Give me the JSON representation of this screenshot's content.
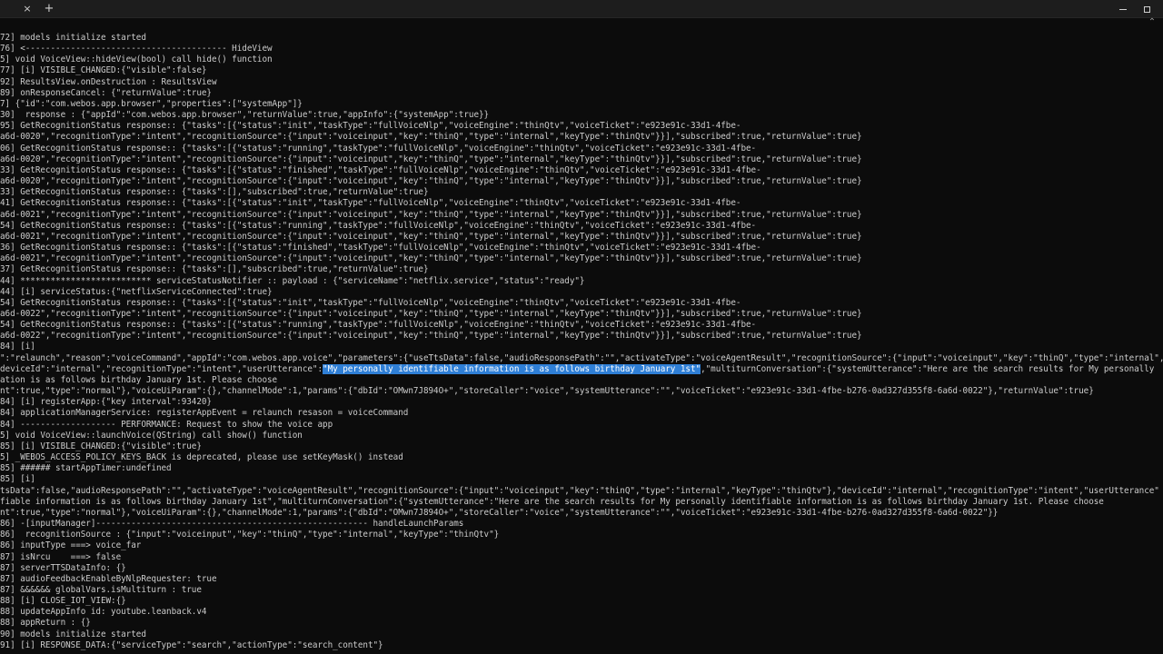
{
  "window": {
    "tab_close_icon": "×",
    "new_tab_icon": "+",
    "minimize_icon": "minimize-icon",
    "maximize_icon": "maximize-icon",
    "scroll_glyph": "⌃"
  },
  "console": {
    "lines": [
      {
        "text": "72] models initialize started"
      },
      {
        "text": "76] <---------------------------------------- HideView"
      },
      {
        "text": "5] void VoiceView::hideView(bool) call hide() function"
      },
      {
        "text": "77] [i] VISIBLE_CHANGED:{\"visible\":false}"
      },
      {
        "text": "92] ResultsView.onDestruction : ResultsView"
      },
      {
        "text": "89] onResponseCancel: {\"returnValue\":true}"
      },
      {
        "text": "7] {\"id\":\"com.webos.app.browser\",\"properties\":[\"systemApp\"]}"
      },
      {
        "text": "30]  response : {\"appId\":\"com.webos.app.browser\",\"returnValue\":true,\"appInfo\":{\"systemApp\":true}}"
      },
      {
        "text": "95] GetRecognitionStatus response:: {\"tasks\":[{\"status\":\"init\",\"taskType\":\"fullVoiceNlp\",\"voiceEngine\":\"thinQtv\",\"voiceTicket\":\"e923e91c-33d1-4fbe-"
      },
      {
        "text": "a6d-0020\",\"recognitionType\":\"intent\",\"recognitionSource\":{\"input\":\"voiceinput\",\"key\":\"thinQ\",\"type\":\"internal\",\"keyType\":\"thinQtv\"}}],\"subscribed\":true,\"returnValue\":true}"
      },
      {
        "text": "06] GetRecognitionStatus response:: {\"tasks\":[{\"status\":\"running\",\"taskType\":\"fullVoiceNlp\",\"voiceEngine\":\"thinQtv\",\"voiceTicket\":\"e923e91c-33d1-4fbe-"
      },
      {
        "text": "a6d-0020\",\"recognitionType\":\"intent\",\"recognitionSource\":{\"input\":\"voiceinput\",\"key\":\"thinQ\",\"type\":\"internal\",\"keyType\":\"thinQtv\"}}],\"subscribed\":true,\"returnValue\":true}"
      },
      {
        "text": "33] GetRecognitionStatus response:: {\"tasks\":[{\"status\":\"finished\",\"taskType\":\"fullVoiceNlp\",\"voiceEngine\":\"thinQtv\",\"voiceTicket\":\"e923e91c-33d1-4fbe-"
      },
      {
        "text": "a6d-0020\",\"recognitionType\":\"intent\",\"recognitionSource\":{\"input\":\"voiceinput\",\"key\":\"thinQ\",\"type\":\"internal\",\"keyType\":\"thinQtv\"}}],\"subscribed\":true,\"returnValue\":true}"
      },
      {
        "text": "33] GetRecognitionStatus response:: {\"tasks\":[],\"subscribed\":true,\"returnValue\":true}"
      },
      {
        "text": "41] GetRecognitionStatus response:: {\"tasks\":[{\"status\":\"init\",\"taskType\":\"fullVoiceNlp\",\"voiceEngine\":\"thinQtv\",\"voiceTicket\":\"e923e91c-33d1-4fbe-"
      },
      {
        "text": "a6d-0021\",\"recognitionType\":\"intent\",\"recognitionSource\":{\"input\":\"voiceinput\",\"key\":\"thinQ\",\"type\":\"internal\",\"keyType\":\"thinQtv\"}}],\"subscribed\":true,\"returnValue\":true}"
      },
      {
        "text": "54] GetRecognitionStatus response:: {\"tasks\":[{\"status\":\"running\",\"taskType\":\"fullVoiceNlp\",\"voiceEngine\":\"thinQtv\",\"voiceTicket\":\"e923e91c-33d1-4fbe-"
      },
      {
        "text": "a6d-0021\",\"recognitionType\":\"intent\",\"recognitionSource\":{\"input\":\"voiceinput\",\"key\":\"thinQ\",\"type\":\"internal\",\"keyType\":\"thinQtv\"}}],\"subscribed\":true,\"returnValue\":true}"
      },
      {
        "text": "36] GetRecognitionStatus response:: {\"tasks\":[{\"status\":\"finished\",\"taskType\":\"fullVoiceNlp\",\"voiceEngine\":\"thinQtv\",\"voiceTicket\":\"e923e91c-33d1-4fbe-"
      },
      {
        "text": "a6d-0021\",\"recognitionType\":\"intent\",\"recognitionSource\":{\"input\":\"voiceinput\",\"key\":\"thinQ\",\"type\":\"internal\",\"keyType\":\"thinQtv\"}}],\"subscribed\":true,\"returnValue\":true}"
      },
      {
        "text": "37] GetRecognitionStatus response:: {\"tasks\":[],\"subscribed\":true,\"returnValue\":true}"
      },
      {
        "text": "44] ************************** serviceStatusNotifier :: payload : {\"serviceName\":\"netflix.service\",\"status\":\"ready\"}"
      },
      {
        "text": "44] [i] serviceStatus:{\"netflixServiceConnected\":true}"
      },
      {
        "text": "54] GetRecognitionStatus response:: {\"tasks\":[{\"status\":\"init\",\"taskType\":\"fullVoiceNlp\",\"voiceEngine\":\"thinQtv\",\"voiceTicket\":\"e923e91c-33d1-4fbe-"
      },
      {
        "text": "a6d-0022\",\"recognitionType\":\"intent\",\"recognitionSource\":{\"input\":\"voiceinput\",\"key\":\"thinQ\",\"type\":\"internal\",\"keyType\":\"thinQtv\"}}],\"subscribed\":true,\"returnValue\":true}"
      },
      {
        "text": "54] GetRecognitionStatus response:: {\"tasks\":[{\"status\":\"running\",\"taskType\":\"fullVoiceNlp\",\"voiceEngine\":\"thinQtv\",\"voiceTicket\":\"e923e91c-33d1-4fbe-"
      },
      {
        "text": "a6d-0022\",\"recognitionType\":\"intent\",\"recognitionSource\":{\"input\":\"voiceinput\",\"key\":\"thinQ\",\"type\":\"internal\",\"keyType\":\"thinQtv\"}}],\"subscribed\":true,\"returnValue\":true}"
      },
      {
        "text": "84] [i]"
      },
      {
        "text": "\":\"relaunch\",\"reason\":\"voiceCommand\",\"appId\":\"com.webos.app.voice\",\"parameters\":{\"useTtsData\":false,\"audioResponsePath\":\"\",\"activateType\":\"voiceAgentResult\",\"recognitionSource\":{\"input\":\"voiceinput\",\"key\":\"thinQ\",\"type\":\"internal\","
      },
      {
        "text": "deviceId\":\"internal\",\"recognitionType\":\"intent\",\"userUtterance\":",
        "highlight": "\"My personally identifiable information is as follows birthday January 1st\"",
        "after": ",\"multiturnConversation\":{\"systemUtterance\":\"Here are the search results for My personally"
      },
      {
        "text": "ation is as follows birthday January 1st. Please choose"
      },
      {
        "text": "nt\":true,\"type\":\"normal\"},\"voiceUiParam\":{},\"channelMode\":1,\"params\":{\"dbId\":\"OMwn7J894O+\",\"storeCaller\":\"voice\",\"systemUtterance\":\"\",\"voiceTicket\":\"e923e91c-33d1-4fbe-b276-0ad327d355f8-6a6d-0022\"},\"returnValue\":true}"
      },
      {
        "text": "84] [i] registerApp:{\"key interval\":93420}"
      },
      {
        "text": "84] applicationManagerService: registerAppEvent = relaunch resason = voiceCommand"
      },
      {
        "text": "84] ------------------- PERFORMANCE: Request to show the voice app"
      },
      {
        "text": "5] void VoiceView::launchVoice(QString) call show() function"
      },
      {
        "text": "85] [i] VISIBLE_CHANGED:{\"visible\":true}"
      },
      {
        "text": "5] _WEBOS_ACCESS_POLICY_KEYS_BACK is deprecated, please use setKeyMask() instead"
      },
      {
        "text": "85] ###### startAppTimer:undefined"
      },
      {
        "text": "85] [i]"
      },
      {
        "text": "tsData\":false,\"audioResponsePath\":\"\",\"activateType\":\"voiceAgentResult\",\"recognitionSource\":{\"input\":\"voiceinput\",\"key\":\"thinQ\",\"type\":\"internal\",\"keyType\":\"thinQtv\"},\"deviceId\":\"internal\",\"recognitionType\":\"intent\",\"userUtterance\""
      },
      {
        "text": "fiable information is as follows birthday January 1st\",\"multiturnConversation\":{\"systemUtterance\":\"Here are the search results for My personally identifiable information is as follows birthday January 1st. Please choose"
      },
      {
        "text": "nt\":true,\"type\":\"normal\"},\"voiceUiParam\":{},\"channelMode\":1,\"params\":{\"dbId\":\"OMwn7J894O+\",\"storeCaller\":\"voice\",\"systemUtterance\":\"\",\"voiceTicket\":\"e923e91c-33d1-4fbe-b276-0ad327d355f8-6a6d-0022\"}}"
      },
      {
        "text": "86] -[inputManager]------------------------------------------------------ handleLaunchParams"
      },
      {
        "text": "86]  recognitionSource : {\"input\":\"voiceinput\",\"key\":\"thinQ\",\"type\":\"internal\",\"keyType\":\"thinQtv\"}"
      },
      {
        "text": "86] inputType ===> voice_far"
      },
      {
        "text": "87] isNrcu    ===> false"
      },
      {
        "text": "87] serverTTSDataInfo: {}"
      },
      {
        "text": "87] audioFeedbackEnableByNlpRequester: true"
      },
      {
        "text": "87] &&&&&& globalVars.isMultiturn : true"
      },
      {
        "text": "88] [i] CLOSE_IOT_VIEW:{}"
      },
      {
        "text": "88] updateAppInfo id: youtube.leanback.v4"
      },
      {
        "text": "88] appReturn : {}"
      },
      {
        "text": "90] models initialize started"
      },
      {
        "text": "91] [i] RESPONSE_DATA:{\"serviceType\":\"search\",\"actionType\":\"search_content\"}"
      }
    ]
  }
}
